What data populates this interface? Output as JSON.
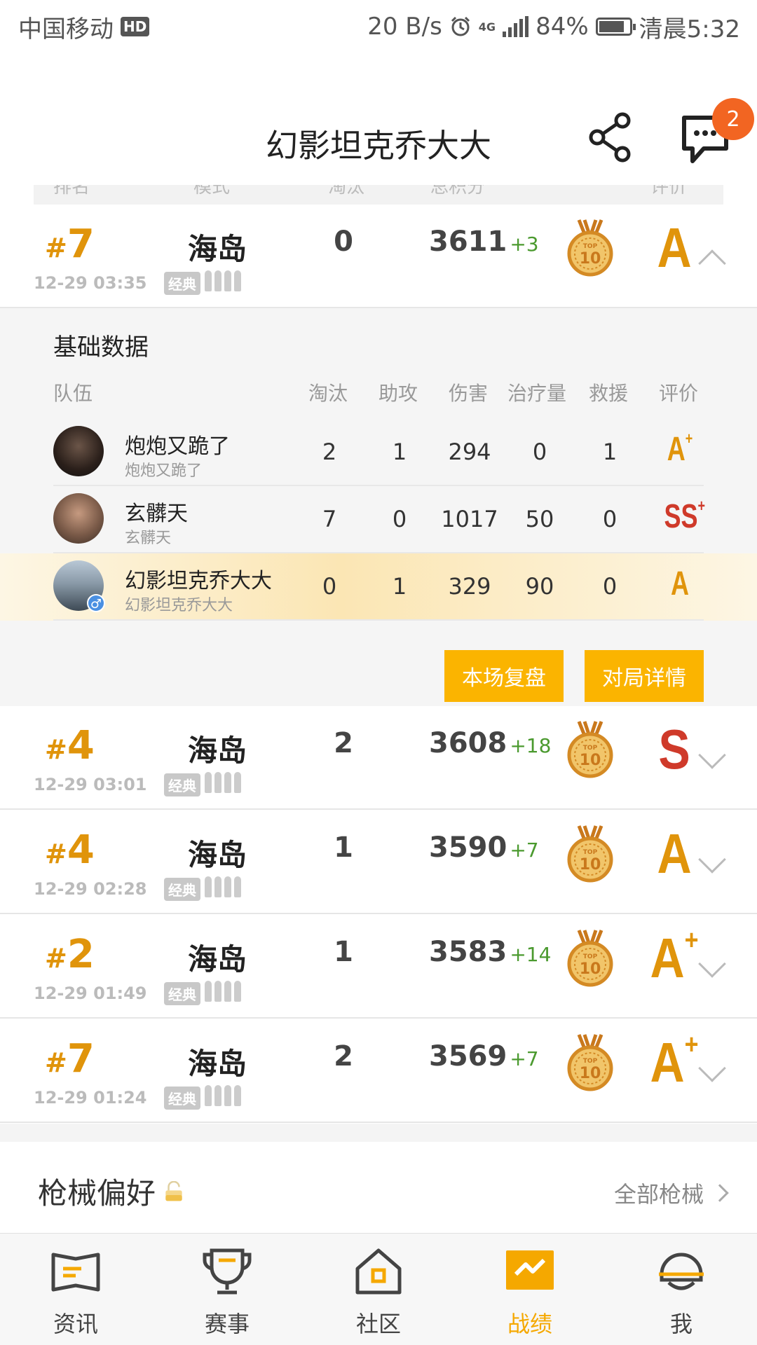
{
  "status_bar": {
    "carrier": "中国移动",
    "hd": "HD",
    "speed": "20 B/s",
    "network": "4G",
    "battery_percent": "84%",
    "battery_level": 0.84,
    "time": "清晨5:32"
  },
  "header": {
    "title": "幻影坦克乔大大",
    "message_count": "2"
  },
  "columns": {
    "rank": "排名",
    "mode": "模式",
    "kills": "淘汰",
    "score": "总积分",
    "grade": "评价"
  },
  "matches": [
    {
      "rank": "7",
      "time": "12-29 03:35",
      "mode": "海岛",
      "mode_tag": "经典",
      "kills": "0",
      "score": "3611",
      "delta": "+3",
      "grade": "A",
      "grade_plus": "",
      "grade_color": "#e0940b",
      "expanded": true
    },
    {
      "rank": "4",
      "time": "12-29 03:01",
      "mode": "海岛",
      "mode_tag": "经典",
      "kills": "2",
      "score": "3608",
      "delta": "+18",
      "grade": "S",
      "grade_plus": "",
      "grade_color": "#cf3a2a",
      "expanded": false
    },
    {
      "rank": "4",
      "time": "12-29 02:28",
      "mode": "海岛",
      "mode_tag": "经典",
      "kills": "1",
      "score": "3590",
      "delta": "+7",
      "grade": "A",
      "grade_plus": "",
      "grade_color": "#e0940b",
      "expanded": false
    },
    {
      "rank": "2",
      "time": "12-29 01:49",
      "mode": "海岛",
      "mode_tag": "经典",
      "kills": "1",
      "score": "3583",
      "delta": "+14",
      "grade": "A",
      "grade_plus": "+",
      "grade_color": "#e0940b",
      "expanded": false
    },
    {
      "rank": "7",
      "time": "12-29 01:24",
      "mode": "海岛",
      "mode_tag": "经典",
      "kills": "2",
      "score": "3569",
      "delta": "+7",
      "grade": "A",
      "grade_plus": "+",
      "grade_color": "#e0940b",
      "expanded": false
    }
  ],
  "detail": {
    "title": "基础数据",
    "headers": {
      "team": "队伍",
      "kills": "淘汰",
      "assists": "助攻",
      "damage": "伤害",
      "heal": "治疗量",
      "revive": "救援",
      "grade": "评价"
    },
    "players": [
      {
        "name": "炮炮又跪了",
        "sub": "炮炮又跪了",
        "kills": "2",
        "assists": "1",
        "damage": "294",
        "heal": "0",
        "revive": "1",
        "grade": "A",
        "grade_plus": "+",
        "grade_color": "#e0940b"
      },
      {
        "name": "玄髒天",
        "sub": "玄髒天",
        "kills": "7",
        "assists": "0",
        "damage": "1017",
        "heal": "50",
        "revive": "0",
        "grade": "SS",
        "grade_plus": "+",
        "grade_color": "#cf3a2a"
      },
      {
        "name": "幻影坦克乔大大",
        "sub": "幻影坦克乔大大",
        "kills": "0",
        "assists": "1",
        "damage": "329",
        "heal": "90",
        "revive": "0",
        "grade": "A",
        "grade_plus": "",
        "grade_color": "#e0940b"
      }
    ],
    "replay_button": "本场复盘",
    "details_button": "对局详情"
  },
  "preference": {
    "title": "枪械偏好",
    "link": "全部枪械"
  },
  "tabs": [
    {
      "label": "资讯",
      "icon": "news-icon"
    },
    {
      "label": "赛事",
      "icon": "trophy-icon"
    },
    {
      "label": "社区",
      "icon": "home-icon"
    },
    {
      "label": "战绩",
      "icon": "stats-icon"
    },
    {
      "label": "我",
      "icon": "profile-icon"
    }
  ],
  "colors": {
    "accent": "#f5a800",
    "rank": "#e0940b",
    "delta": "#4b9a2f",
    "badge": "#f26522"
  }
}
